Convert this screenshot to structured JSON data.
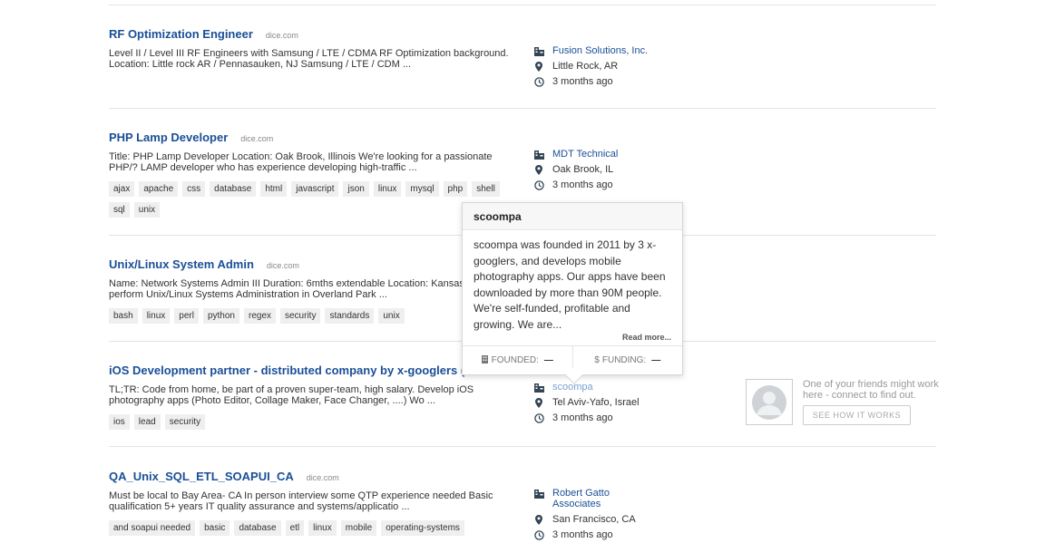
{
  "jobs": [
    {
      "title": "RF Optimization Engineer",
      "source": "dice.com",
      "description": "Level II / Level III RF Engineers with Samsung / LTE / CDMA RF Optimization background. Location: Little rock AR / Pennasauken, NJ Samsung / LTE / CDM ...",
      "tags": [],
      "company": "Fusion Solutions, Inc.",
      "location": "Little Rock, AR",
      "posted": "3 months ago"
    },
    {
      "title": "PHP Lamp Developer",
      "source": "dice.com",
      "description": "Title: PHP Lamp Developer Location: Oak Brook, Illinois We're looking for a passionate PHP/? LAMP developer who has experience developing high-traffic ...",
      "tags": [
        "ajax",
        "apache",
        "css",
        "database",
        "html",
        "javascript",
        "json",
        "linux",
        "mysql",
        "php",
        "shell",
        "sql",
        "unix"
      ],
      "company": "MDT Technical",
      "location": "Oak Brook, IL",
      "posted": "3 months ago"
    },
    {
      "title": "Unix/Linux System Admin",
      "source": "dice.com",
      "description": "Name: Network Systems Admin III Duration: 6mths extendable Location: Kansas-Ov... perform Unix/Linux Systems Administration in Overland Park ...",
      "tags": [
        "bash",
        "linux",
        "perl",
        "python",
        "regex",
        "security",
        "standards",
        "unix"
      ],
      "company": "",
      "location": "",
      "posted": ""
    },
    {
      "title": "iOS Development partner - distributed company by x-googlers (work from...",
      "source": "",
      "description": "TL;TR: Code from home, be part of a proven super-team, high salary. Develop iOS photography apps (Photo Editor, Collage Maker, Face Changer, ....) Wo ...",
      "tags": [
        "ios",
        "lead",
        "security"
      ],
      "company": "scoompa",
      "location": "Tel Aviv-Yafo, Israel",
      "posted": "3 months ago"
    },
    {
      "title": "QA_Unix_SQL_ETL_SOAPUI_CA",
      "source": "dice.com",
      "description": "Must be local to Bay Area- CA In person interview some QTP experience needed Basic qualification 5+ years IT quality assurance and systems/applicatio ...",
      "tags": [
        "and soapui needed",
        "basic",
        "database",
        "etl",
        "linux",
        "mobile",
        "operating-systems"
      ],
      "company": "Robert Gatto Associates",
      "location": "San Francisco, CA",
      "posted": "3 months ago"
    }
  ],
  "popover": {
    "title": "scoompa",
    "body": "scoompa was founded in 2011 by 3 x-googlers, and develops mobile photography apps. Our apps have been downloaded by more than 90M people. We're self-funded, profitable and growing. We are...",
    "read_more": "Read more...",
    "founded_label": "FOUNDED:",
    "founded_value": "—",
    "funding_label": "FUNDING:",
    "funding_value": "—"
  },
  "friends": {
    "text": "One of your friends might work here - connect to find out.",
    "button": "SEE HOW IT WORKS"
  },
  "colors": {
    "link": "#1a4f97",
    "tag_bg": "#efefef",
    "muted": "#999999"
  }
}
